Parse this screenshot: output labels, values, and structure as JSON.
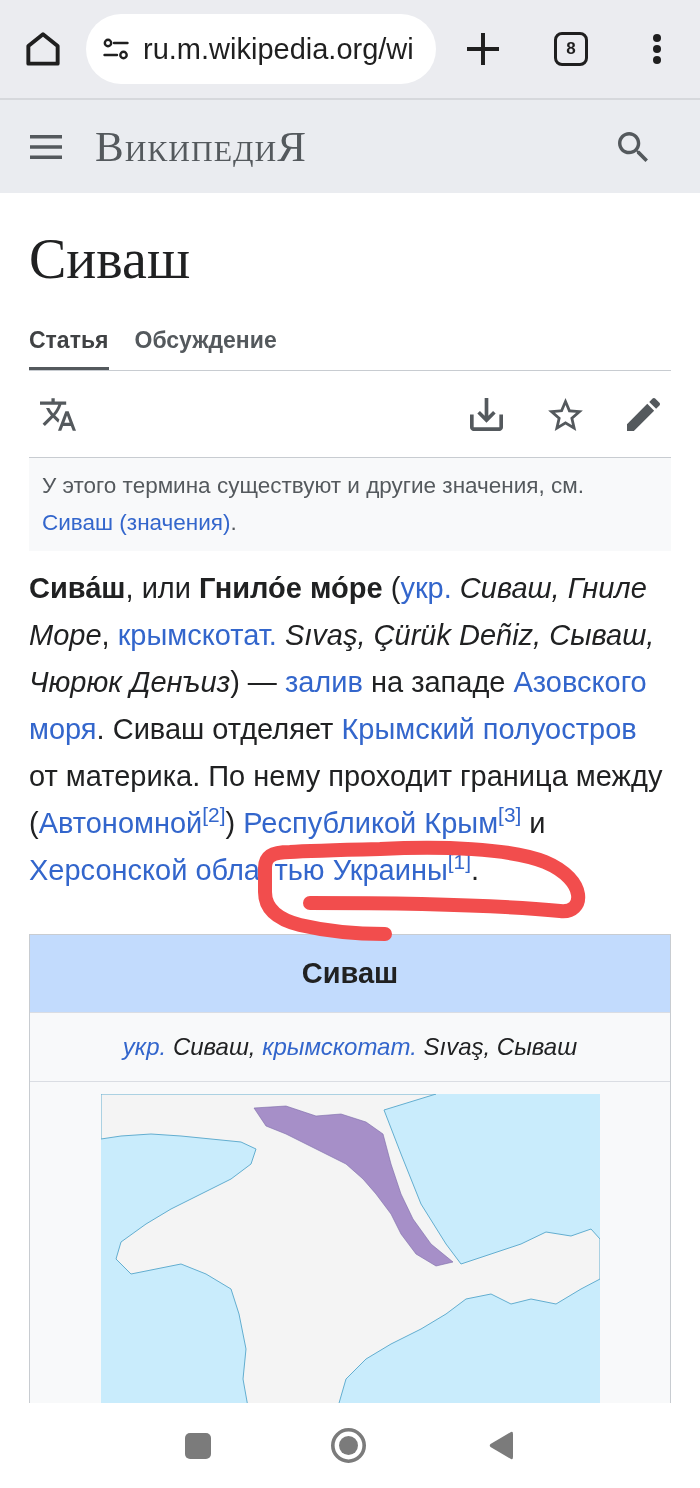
{
  "browser": {
    "url": "ru.m.wikipedia.org/wi",
    "tab_count": "8"
  },
  "header": {
    "logo": "ВикипедиЯ"
  },
  "article": {
    "title": "Сиваш",
    "tabs": [
      {
        "label": "Статья",
        "selected": true
      },
      {
        "label": "Обсуждение",
        "selected": false
      }
    ],
    "hatnote": [
      {
        "kind": "text",
        "text": "У этого термина существуют и другие значения, см. "
      },
      {
        "kind": "link",
        "text": "Сиваш (значения)"
      },
      {
        "kind": "text",
        "text": "."
      }
    ],
    "lead": [
      {
        "kind": "text",
        "text": "**Сива́ш**, или **Гнило́е мо́ре** ("
      },
      {
        "kind": "link",
        "text": "укр."
      },
      {
        "kind": "text",
        "text": " *Сиваш, Гниле Море*, "
      },
      {
        "kind": "link",
        "text": "крымскотат."
      },
      {
        "kind": "text",
        "text": " *Sıvaş, Çürük Deñiz, Сываш, Чюрюк Денъиз*) — "
      },
      {
        "kind": "link",
        "text": "залив"
      },
      {
        "kind": "text",
        "text": " на западе "
      },
      {
        "kind": "wrapped_link",
        "parts": [
          "Азовского",
          "моря"
        ]
      },
      {
        "kind": "text",
        "text": ". Сиваш отделяет "
      },
      {
        "kind": "link",
        "text": "Крымский полуостров"
      },
      {
        "kind": "text",
        "text": " от материка. По нему проходит граница между ("
      },
      {
        "kind": "link",
        "text": "Автономной"
      },
      {
        "kind": "ref",
        "text": "[2]"
      },
      {
        "kind": "text",
        "text": ") "
      },
      {
        "kind": "link",
        "text": "Республикой Крым"
      },
      {
        "kind": "ref",
        "text": "[3]"
      },
      {
        "kind": "text",
        "text": " и "
      },
      {
        "kind": "occluded_link",
        "parts": [
          "Херсонской обла",
          "тью Украины"
        ]
      },
      {
        "kind": "ref",
        "text": "[1]"
      },
      {
        "kind": "text",
        "text": "."
      }
    ]
  },
  "infobox": {
    "title": "Сиваш",
    "subtitle": [
      {
        "kind": "link",
        "text": "укр."
      },
      {
        "kind": "text",
        "text": " Сиваш, "
      },
      {
        "kind": "link",
        "text": "крымскотат."
      },
      {
        "kind": "text",
        "text": " Sıvaş, Сываш"
      }
    ]
  }
}
